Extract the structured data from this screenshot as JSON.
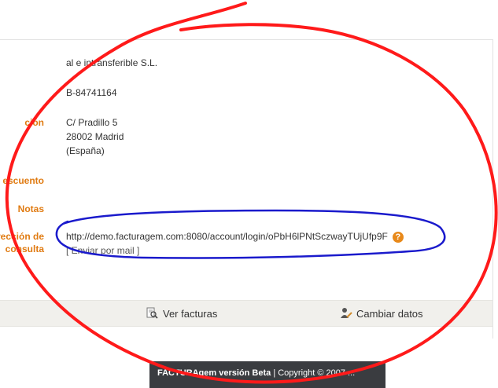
{
  "company": {
    "name_partial": "al e intransferible S.L.",
    "nif_partial": "B-84741164"
  },
  "labels": {
    "address_partial": "ción",
    "discount_partial": "escuento",
    "notes": "Notas",
    "link_line1": "rección de",
    "link_line2": "consulta"
  },
  "address": {
    "line1": "C/ Pradillo 5",
    "line2": "28002 Madrid",
    "line3": "(España)"
  },
  "access": {
    "url": "http://demo.facturagem.com:8080/account/login/oPbH6lPNtSczwayTUjUfp9F",
    "send_link": "[ Enviar por mail ]",
    "help_icon": "?"
  },
  "actions": {
    "view_invoices": "Ver facturas",
    "change_data": "Cambiar datos"
  },
  "footer": {
    "brand": "FACTURAgem versión Beta",
    "copyright": " | Copyright © 2007 ..."
  },
  "colors": {
    "label_orange": "#e07b12",
    "annotation_red": "#ff1a1a",
    "annotation_blue": "#1a1acc"
  }
}
